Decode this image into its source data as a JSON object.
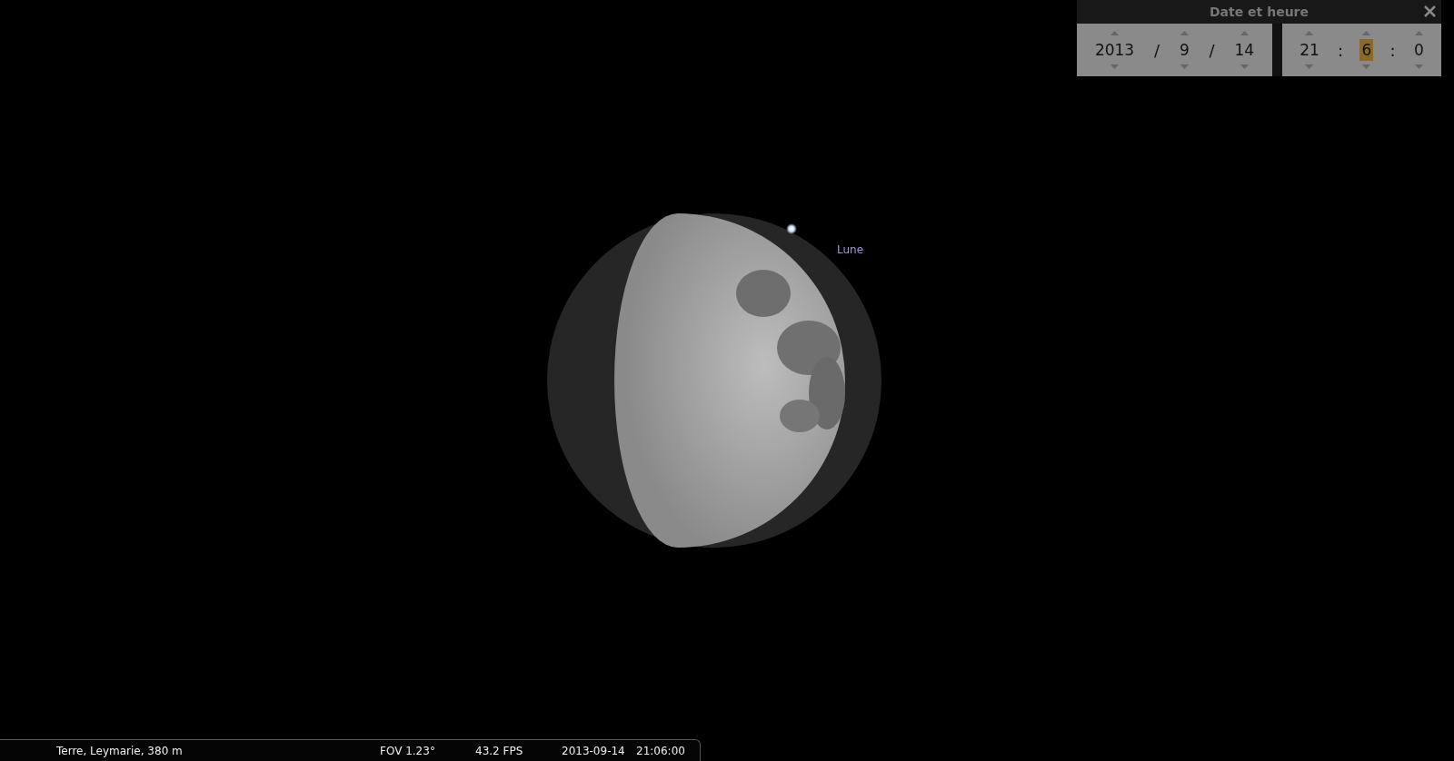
{
  "sky": {
    "object_label": "Lune"
  },
  "date_dialog": {
    "title": "Date et heure",
    "date_fields": [
      {
        "value": "2013",
        "selected": false
      },
      {
        "value": "9",
        "selected": false
      },
      {
        "value": "14",
        "selected": false
      }
    ],
    "date_separators": [
      "/",
      "/"
    ],
    "time_fields": [
      {
        "value": "21",
        "selected": false
      },
      {
        "value": "6",
        "selected": true
      },
      {
        "value": "0",
        "selected": false
      }
    ],
    "time_separators": [
      ":",
      ":"
    ]
  },
  "status_bar": {
    "location": "Terre, Leymarie, 380 m",
    "fov": "FOV 1.23°",
    "fps": "43.2 FPS",
    "date": "2013-09-14",
    "time": "21:06:00"
  }
}
